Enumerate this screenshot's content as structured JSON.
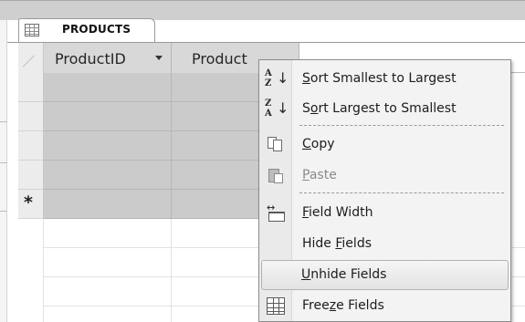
{
  "tab": {
    "title": "PRODUCTS"
  },
  "columns": [
    {
      "label": "ProductID",
      "has_dropdown": true
    },
    {
      "label": "Product",
      "has_dropdown": false
    }
  ],
  "new_record_marker": "*",
  "context_menu": {
    "items": [
      {
        "id": "sort-asc",
        "icon": "sort-ascending-icon",
        "icon_top": "A",
        "icon_bottom": "Z",
        "prefix": "",
        "accel": "S",
        "suffix": "ort Smallest to Largest",
        "disabled": false
      },
      {
        "id": "sort-desc",
        "icon": "sort-descending-icon",
        "icon_top": "Z",
        "icon_bottom": "A",
        "prefix": "S",
        "accel": "o",
        "suffix": "rt Largest to Smallest",
        "disabled": false
      },
      {
        "id": "copy",
        "icon": "copy-icon",
        "prefix": "",
        "accel": "C",
        "suffix": "opy",
        "disabled": false
      },
      {
        "id": "paste",
        "icon": "paste-icon",
        "prefix": "",
        "accel": "P",
        "suffix": "aste",
        "disabled": true
      },
      {
        "id": "field-width",
        "icon": "field-width-icon",
        "prefix": "",
        "accel": "F",
        "suffix": "ield Width",
        "disabled": false
      },
      {
        "id": "hide-fields",
        "icon": "",
        "prefix": "Hide ",
        "accel": "F",
        "suffix": "ields",
        "disabled": false
      },
      {
        "id": "unhide-fields",
        "icon": "",
        "prefix": "",
        "accel": "U",
        "suffix": "nhide Fields",
        "disabled": false,
        "highlighted": true
      },
      {
        "id": "freeze-fields",
        "icon": "freeze-fields-icon",
        "prefix": "Free",
        "accel": "z",
        "suffix": "e Fields",
        "disabled": false
      }
    ]
  },
  "colors": {
    "header_bg": "#d8d8d8",
    "selected_row_bg": "#cbcbcb",
    "menu_bg": "#f3f3f3",
    "disabled_text": "#8a8a8a"
  }
}
